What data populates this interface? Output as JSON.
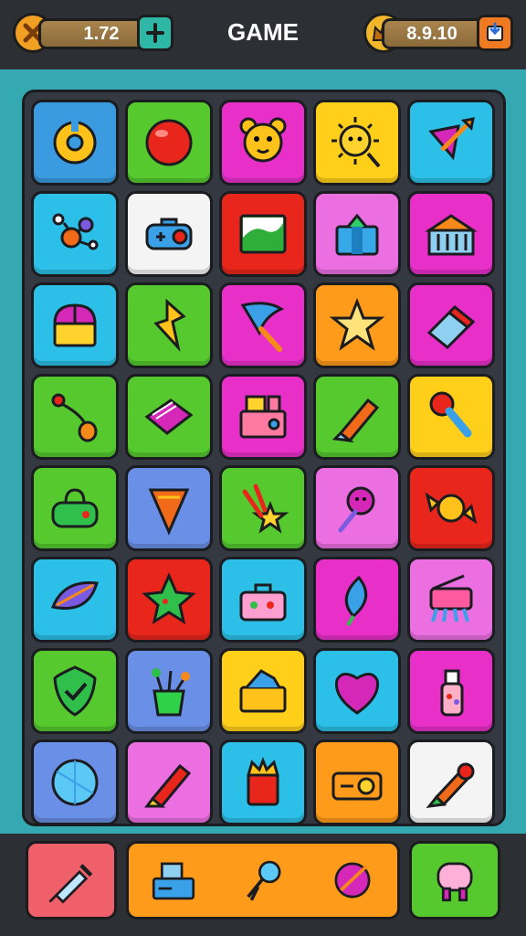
{
  "header": {
    "title": "GAME",
    "left_counter": "1.72",
    "right_counter": "8.9.10",
    "left_button_icon": "close-icon",
    "plus_button_icon": "plus-icon",
    "right_badge_icon": "crown-icon",
    "exit_button_icon": "exit-icon"
  },
  "colors": {
    "blue": "#3a9be0",
    "green": "#55c92e",
    "magenta": "#e830c8",
    "yellow": "#ffcf1a",
    "cyan": "#2cc0e8",
    "red": "#e8261c",
    "orange": "#ff9b1a",
    "pink": "#ec6fe2",
    "periwinkle": "#6a8fe6",
    "white": "#f4f4f4",
    "board_frame": "#35a9b1"
  },
  "board": {
    "rows": 8,
    "cols": 5,
    "tiles": [
      {
        "color": "blue",
        "icon": "donut-icon"
      },
      {
        "color": "green",
        "icon": "red-ball-icon"
      },
      {
        "color": "magenta",
        "icon": "bear-face-icon"
      },
      {
        "color": "yellow",
        "icon": "sun-face-icon"
      },
      {
        "color": "cyan",
        "icon": "kite-arrow-icon"
      },
      {
        "color": "cyan",
        "icon": "molecule-icon"
      },
      {
        "color": "white",
        "icon": "gamepad-icon"
      },
      {
        "color": "red",
        "icon": "landscape-picture-icon"
      },
      {
        "color": "pink",
        "icon": "gift-box-icon"
      },
      {
        "color": "magenta",
        "icon": "building-icon"
      },
      {
        "color": "cyan",
        "icon": "chest-icon"
      },
      {
        "color": "green",
        "icon": "lightning-gem-icon"
      },
      {
        "color": "magenta",
        "icon": "blue-flag-icon"
      },
      {
        "color": "orange",
        "icon": "star-icon"
      },
      {
        "color": "magenta",
        "icon": "eraser-icon"
      },
      {
        "color": "green",
        "icon": "stethoscope-icon"
      },
      {
        "color": "green",
        "icon": "notebook-icon"
      },
      {
        "color": "magenta",
        "icon": "radio-icon"
      },
      {
        "color": "green",
        "icon": "crayon-icon"
      },
      {
        "color": "yellow",
        "icon": "paintbrush-icon"
      },
      {
        "color": "green",
        "icon": "handbag-icon"
      },
      {
        "color": "periwinkle",
        "icon": "ice-cream-cone-icon"
      },
      {
        "color": "green",
        "icon": "star-wand-icon"
      },
      {
        "color": "pink",
        "icon": "flower-rattle-icon"
      },
      {
        "color": "red",
        "icon": "candy-icon"
      },
      {
        "color": "cyan",
        "icon": "leaf-icon"
      },
      {
        "color": "red",
        "icon": "green-star-icon"
      },
      {
        "color": "cyan",
        "icon": "toolbox-icon"
      },
      {
        "color": "magenta",
        "icon": "feather-balloon-icon"
      },
      {
        "color": "pink",
        "icon": "projector-icon"
      },
      {
        "color": "green",
        "icon": "shield-check-icon"
      },
      {
        "color": "periwinkle",
        "icon": "plant-pot-icon"
      },
      {
        "color": "yellow",
        "icon": "basket-icon"
      },
      {
        "color": "cyan",
        "icon": "heart-badge-icon"
      },
      {
        "color": "magenta",
        "icon": "bottle-icon"
      },
      {
        "color": "periwinkle",
        "icon": "blue-orb-icon"
      },
      {
        "color": "pink",
        "icon": "red-crayon-icon"
      },
      {
        "color": "cyan",
        "icon": "crown-box-icon"
      },
      {
        "color": "orange",
        "icon": "cassette-icon"
      },
      {
        "color": "white",
        "icon": "rocket-pen-icon"
      }
    ]
  },
  "tray": {
    "slots": [
      {
        "color": "#f0606a",
        "icons": [
          "syringe-icon"
        ]
      },
      {
        "color": "#ff9b1a",
        "icons": [
          "cash-register-icon",
          "robot-toy-icon",
          "feather-ball-icon"
        ]
      },
      {
        "color": "#55c92e",
        "icons": [
          "pink-creature-icon"
        ]
      }
    ]
  }
}
